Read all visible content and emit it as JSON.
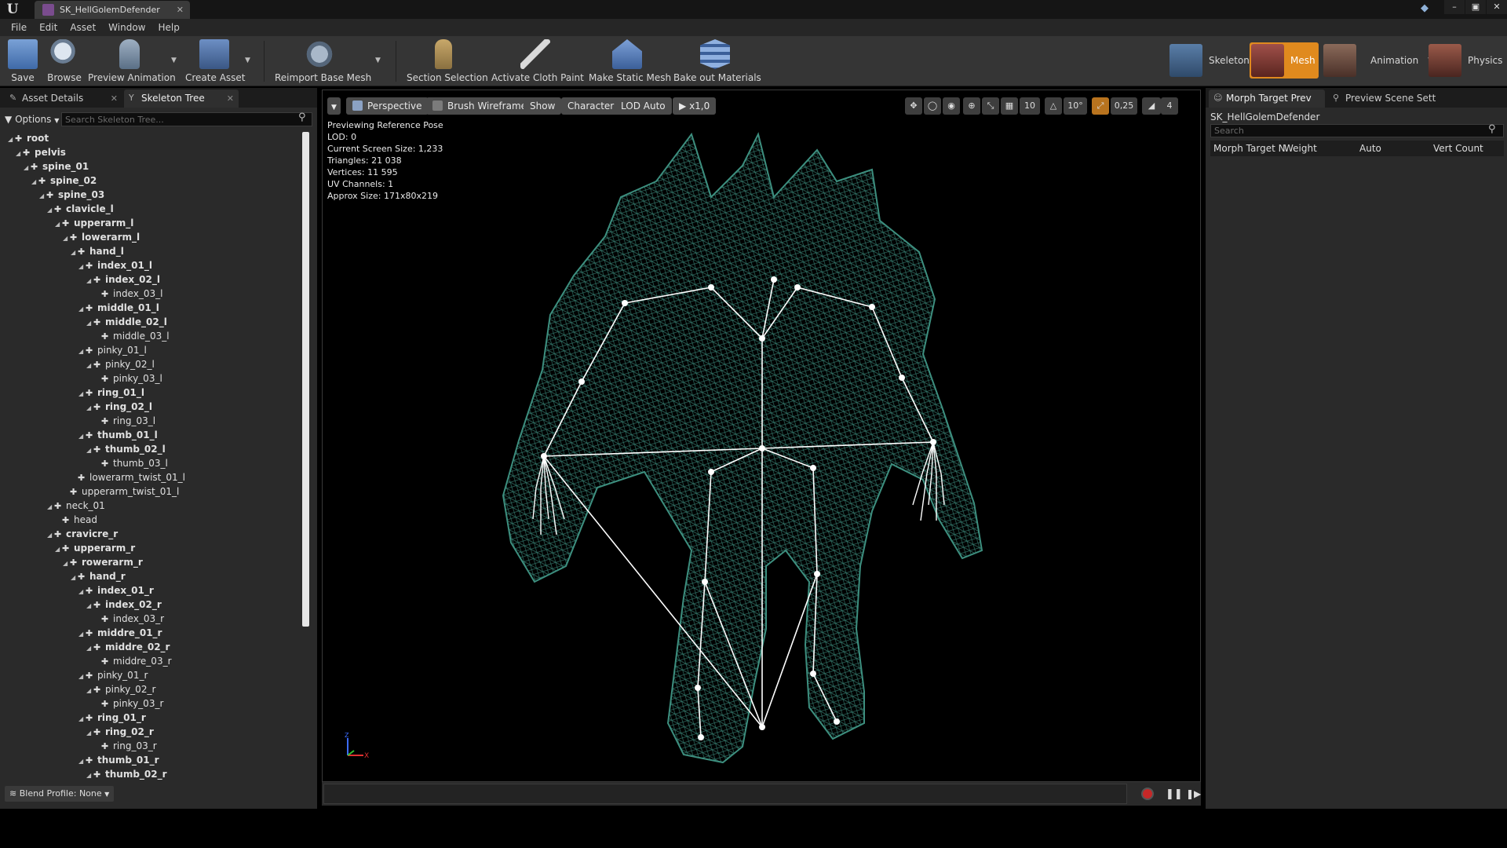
{
  "window": {
    "tab_title": "SK_HellGolemDefender",
    "controls": [
      "–",
      "▣",
      "✕"
    ]
  },
  "menu": [
    "File",
    "Edit",
    "Asset",
    "Window",
    "Help"
  ],
  "toolbar": {
    "save": "Save",
    "browse": "Browse",
    "preview_animation": "Preview Animation",
    "create_asset": "Create Asset",
    "reimport": "Reimport Base Mesh",
    "section_selection": "Section Selection",
    "activate_cloth": "Activate Cloth Paint",
    "make_static": "Make Static Mesh",
    "bake_materials": "Bake out Materials"
  },
  "modes": {
    "skeleton": "Skeleton",
    "mesh": "Mesh",
    "animation": "Animation",
    "physics": "Physics",
    "active": "Mesh",
    "active_color": "#e08a1e"
  },
  "left_panel": {
    "tabs": [
      "Asset Details",
      "Skeleton Tree"
    ],
    "options": "Options",
    "search_placeholder": "Search Skeleton Tree...",
    "blend_profile": "Blend Profile: None",
    "bones": [
      {
        "name": "root",
        "depth": 0,
        "expand": true,
        "bold": true
      },
      {
        "name": "pelvis",
        "depth": 1,
        "expand": true,
        "bold": true
      },
      {
        "name": "spine_01",
        "depth": 2,
        "expand": true,
        "bold": true
      },
      {
        "name": "spine_02",
        "depth": 3,
        "expand": true,
        "bold": true
      },
      {
        "name": "spine_03",
        "depth": 4,
        "expand": true,
        "bold": true
      },
      {
        "name": "clavicle_l",
        "depth": 5,
        "expand": true,
        "bold": true
      },
      {
        "name": "upperarm_l",
        "depth": 6,
        "expand": true,
        "bold": true
      },
      {
        "name": "lowerarm_l",
        "depth": 7,
        "expand": true,
        "bold": true
      },
      {
        "name": "hand_l",
        "depth": 8,
        "expand": true,
        "bold": true
      },
      {
        "name": "index_01_l",
        "depth": 9,
        "expand": true,
        "bold": true
      },
      {
        "name": "index_02_l",
        "depth": 10,
        "expand": true,
        "bold": true
      },
      {
        "name": "index_03_l",
        "depth": 11,
        "expand": false,
        "bold": false
      },
      {
        "name": "middle_01_l",
        "depth": 9,
        "expand": true,
        "bold": true
      },
      {
        "name": "middle_02_l",
        "depth": 10,
        "expand": true,
        "bold": true
      },
      {
        "name": "middle_03_l",
        "depth": 11,
        "expand": false,
        "bold": false
      },
      {
        "name": "pinky_01_l",
        "depth": 9,
        "expand": true,
        "bold": false
      },
      {
        "name": "pinky_02_l",
        "depth": 10,
        "expand": true,
        "bold": false
      },
      {
        "name": "pinky_03_l",
        "depth": 11,
        "expand": false,
        "bold": false
      },
      {
        "name": "ring_01_l",
        "depth": 9,
        "expand": true,
        "bold": true
      },
      {
        "name": "ring_02_l",
        "depth": 10,
        "expand": true,
        "bold": true
      },
      {
        "name": "ring_03_l",
        "depth": 11,
        "expand": false,
        "bold": false
      },
      {
        "name": "thumb_01_l",
        "depth": 9,
        "expand": true,
        "bold": true
      },
      {
        "name": "thumb_02_l",
        "depth": 10,
        "expand": true,
        "bold": true
      },
      {
        "name": "thumb_03_l",
        "depth": 11,
        "expand": false,
        "bold": false
      },
      {
        "name": "lowerarm_twist_01_l",
        "depth": 8,
        "expand": false,
        "bold": false
      },
      {
        "name": "upperarm_twist_01_l",
        "depth": 7,
        "expand": false,
        "bold": false
      },
      {
        "name": "neck_01",
        "depth": 5,
        "expand": true,
        "bold": false
      },
      {
        "name": "head",
        "depth": 6,
        "expand": false,
        "bold": false
      },
      {
        "name": "cravicre_r",
        "depth": 5,
        "expand": true,
        "bold": true
      },
      {
        "name": "upperarm_r",
        "depth": 6,
        "expand": true,
        "bold": true
      },
      {
        "name": "rowerarm_r",
        "depth": 7,
        "expand": true,
        "bold": true
      },
      {
        "name": "hand_r",
        "depth": 8,
        "expand": true,
        "bold": true
      },
      {
        "name": "index_01_r",
        "depth": 9,
        "expand": true,
        "bold": true
      },
      {
        "name": "index_02_r",
        "depth": 10,
        "expand": true,
        "bold": true
      },
      {
        "name": "index_03_r",
        "depth": 11,
        "expand": false,
        "bold": false
      },
      {
        "name": "middre_01_r",
        "depth": 9,
        "expand": true,
        "bold": true
      },
      {
        "name": "middre_02_r",
        "depth": 10,
        "expand": true,
        "bold": true
      },
      {
        "name": "middre_03_r",
        "depth": 11,
        "expand": false,
        "bold": false
      },
      {
        "name": "pinky_01_r",
        "depth": 9,
        "expand": true,
        "bold": false
      },
      {
        "name": "pinky_02_r",
        "depth": 10,
        "expand": true,
        "bold": false
      },
      {
        "name": "pinky_03_r",
        "depth": 11,
        "expand": false,
        "bold": false
      },
      {
        "name": "ring_01_r",
        "depth": 9,
        "expand": true,
        "bold": true
      },
      {
        "name": "ring_02_r",
        "depth": 10,
        "expand": true,
        "bold": true
      },
      {
        "name": "ring_03_r",
        "depth": 11,
        "expand": false,
        "bold": false
      },
      {
        "name": "thumb_01_r",
        "depth": 9,
        "expand": true,
        "bold": true
      },
      {
        "name": "thumb_02_r",
        "depth": 10,
        "expand": true,
        "bold": true
      }
    ]
  },
  "viewport": {
    "buttons": {
      "perspective": "Perspective",
      "brush_wireframe": "Brush Wireframe",
      "show": "Show",
      "character": "Character",
      "lod": "LOD Auto",
      "speed": "x1,0"
    },
    "right_controls": {
      "grid_snap": "10",
      "rotate_snap": "10°",
      "scale_snap": "0,25",
      "camera_speed": "4"
    },
    "info": [
      "Previewing Reference Pose",
      "LOD: 0",
      "Current Screen Size: 1,233",
      "Triangles: 21 038",
      "Vertices: 11 595",
      "UV Channels: 1",
      "Approx Size: 171x80x219"
    ],
    "wireframe_color": "#3d8f7f",
    "bone_color": "#ffffff",
    "axis": {
      "x": "X",
      "z": "Z"
    }
  },
  "right_panel": {
    "tabs": [
      "Morph Target Prev",
      "Preview Scene Sett"
    ],
    "mesh_name": "SK_HellGolemDefender",
    "search_placeholder": "Search",
    "columns": [
      "Morph Target N",
      "Weight",
      "Auto",
      "Vert Count"
    ]
  }
}
